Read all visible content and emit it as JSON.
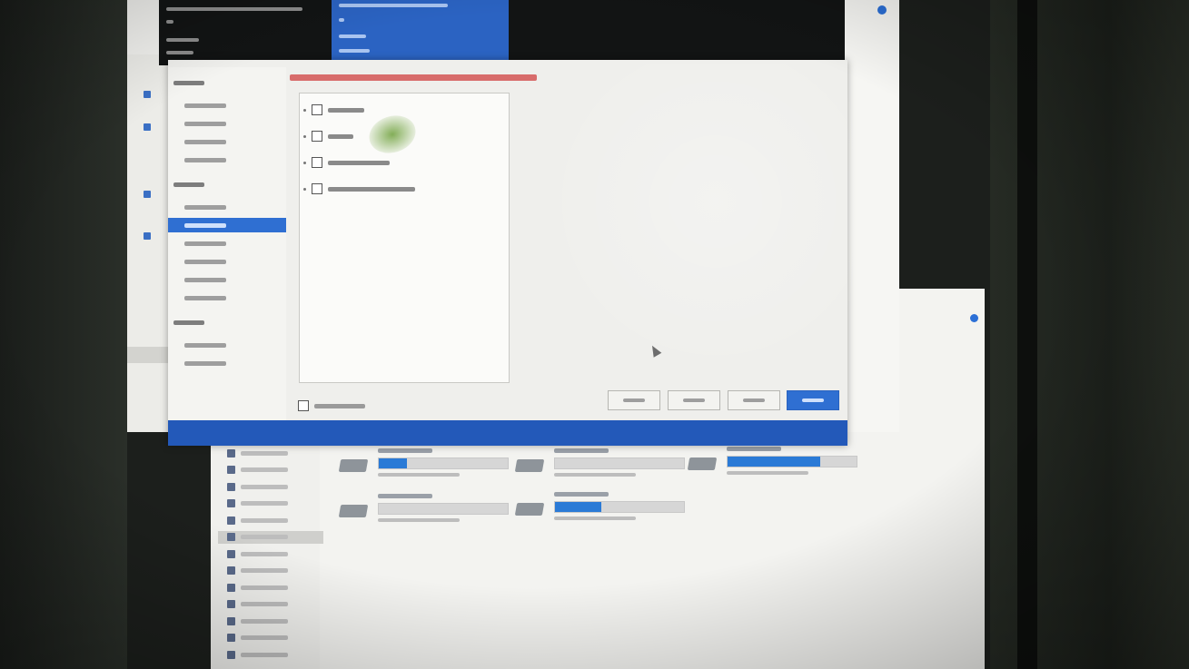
{
  "capture": {
    "legibility": "illegible",
    "kind": "photo of a monitor"
  },
  "colors": {
    "accent": "#2f6fd2",
    "footer_bar": "#2359b9",
    "warning": "#d04040",
    "banner": "#121414"
  },
  "banner": {
    "left_title": "",
    "right_title": ""
  },
  "dialog": {
    "warning_text": "",
    "sidebar": {
      "sections": [
        {
          "label": "",
          "items": [
            {
              "label": ""
            },
            {
              "label": ""
            },
            {
              "label": ""
            },
            {
              "label": ""
            }
          ]
        },
        {
          "label": "",
          "items": [
            {
              "label": ""
            },
            {
              "label": "",
              "active": true
            },
            {
              "label": ""
            },
            {
              "label": ""
            },
            {
              "label": ""
            },
            {
              "label": ""
            }
          ]
        },
        {
          "label": "",
          "items": [
            {
              "label": ""
            },
            {
              "label": ""
            }
          ]
        }
      ]
    },
    "options": [
      {
        "label": "",
        "checked": false
      },
      {
        "label": "",
        "checked": false
      },
      {
        "label": "",
        "checked": false
      },
      {
        "label": "",
        "checked": false
      }
    ],
    "bottom_checkbox": {
      "label": "",
      "checked": false
    },
    "buttons": [
      {
        "label": ""
      },
      {
        "label": ""
      },
      {
        "label": ""
      },
      {
        "label": "",
        "primary": true
      }
    ]
  },
  "explorer": {
    "nav_items": [
      {
        "label": ""
      },
      {
        "label": ""
      },
      {
        "label": ""
      },
      {
        "label": ""
      },
      {
        "label": ""
      },
      {
        "label": "",
        "selected": true
      },
      {
        "label": ""
      },
      {
        "label": ""
      },
      {
        "label": ""
      },
      {
        "label": ""
      },
      {
        "label": ""
      },
      {
        "label": ""
      },
      {
        "label": ""
      }
    ],
    "drives": [
      {
        "label": "",
        "usage_fraction": 0.22,
        "detail": ""
      },
      {
        "label": "",
        "usage_fraction": 0.0,
        "detail": ""
      },
      {
        "label": "",
        "usage_fraction": 0.72,
        "detail": ""
      },
      {
        "label": "",
        "usage_fraction": 0.0,
        "detail": ""
      },
      {
        "label": "",
        "usage_fraction": 0.36,
        "detail": ""
      }
    ]
  }
}
